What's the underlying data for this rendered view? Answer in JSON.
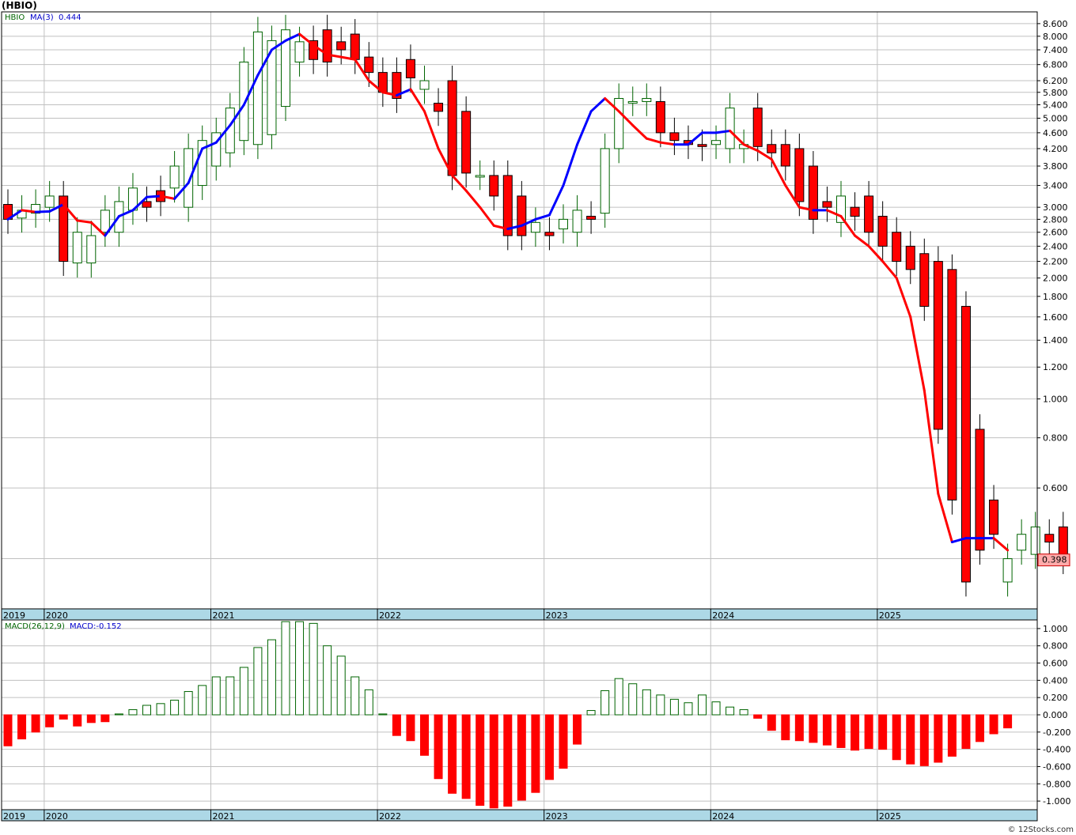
{
  "title": "(HBIO)",
  "price_panel": {
    "ticker": "HBIO",
    "ma_label": "MA(3)",
    "ma_value": "0.444",
    "last_price_label": "0.398",
    "y_ticks": [
      "8.600",
      "8.000",
      "7.400",
      "6.800",
      "6.200",
      "5.800",
      "5.400",
      "5.000",
      "4.600",
      "4.200",
      "3.800",
      "3.400",
      "3.000",
      "2.800",
      "2.600",
      "2.400",
      "2.200",
      "2.000",
      "1.800",
      "1.600",
      "1.400",
      "1.200",
      "1.000",
      "0.800",
      "0.600",
      "0.400"
    ]
  },
  "macd_panel": {
    "label": "MACD(26,12,9)",
    "value_label": "MACD:-0.152",
    "y_ticks": [
      "1.000",
      "0.800",
      "0.600",
      "0.400",
      "0.200",
      "0.000",
      "-0.200",
      "-0.400",
      "-0.600",
      "-0.800",
      "-1.000"
    ]
  },
  "year_labels": [
    "2019",
    "2020",
    "2021",
    "2022",
    "2023",
    "2024",
    "2025"
  ],
  "watermark": "© 12Stocks.com",
  "colors": {
    "up": "#006400",
    "down": "#ff0000",
    "ma_up": "#0000ff",
    "ma_down": "#ff0000",
    "axis_band": "#add8e6",
    "grid": "#c0c0c0",
    "price_box": "#ffaaaa"
  },
  "chart_data": [
    {
      "type": "candlestick",
      "scale": "log",
      "ylim": [
        0.3,
        9.2
      ],
      "x": [
        "2019-12",
        "2020-01",
        "2020-02",
        "2020-03",
        "2020-04",
        "2020-05",
        "2020-06",
        "2020-07",
        "2020-08",
        "2020-09",
        "2020-10",
        "2020-11",
        "2020-12",
        "2021-01",
        "2021-02",
        "2021-03",
        "2021-04",
        "2021-05",
        "2021-06",
        "2021-07",
        "2021-08",
        "2021-09",
        "2021-10",
        "2021-11",
        "2021-12",
        "2022-01",
        "2022-02",
        "2022-03",
        "2022-04",
        "2022-05",
        "2022-06",
        "2022-07",
        "2022-08",
        "2022-09",
        "2022-10",
        "2022-11",
        "2022-12",
        "2023-01",
        "2023-02",
        "2023-03",
        "2023-04",
        "2023-05",
        "2023-06",
        "2023-07",
        "2023-08",
        "2023-09",
        "2023-10",
        "2023-11",
        "2023-12",
        "2024-01",
        "2024-02",
        "2024-03",
        "2024-04",
        "2024-05",
        "2024-06",
        "2024-07",
        "2024-08",
        "2024-09",
        "2024-10",
        "2024-11",
        "2024-12",
        "2025-01",
        "2025-02",
        "2025-03",
        "2025-04",
        "2025-05",
        "2025-06",
        "2025-07",
        "2025-08",
        "2025-09",
        "2025-10",
        "2025-11",
        "2025-12"
      ],
      "series": [
        {
          "name": "HBIO",
          "open": [
            3.05,
            2.82,
            2.9,
            3.0,
            3.2,
            2.18,
            2.18,
            2.6,
            2.6,
            2.95,
            3.1,
            3.3,
            3.35,
            3.0,
            3.4,
            3.8,
            4.1,
            4.4,
            4.3,
            4.55,
            5.35,
            6.9,
            7.8,
            8.3,
            7.75,
            8.1,
            7.1,
            6.5,
            6.5,
            7.0,
            5.9,
            5.45,
            6.2,
            5.2,
            3.6,
            3.6,
            3.6,
            3.2,
            2.6,
            2.6,
            2.65,
            2.6,
            2.85,
            2.9,
            4.2,
            5.5,
            5.5,
            5.5,
            4.6,
            4.4,
            4.3,
            4.3,
            4.2,
            4.2,
            5.3,
            4.3,
            4.3,
            4.2,
            3.8,
            3.1,
            2.75,
            3.0,
            3.2,
            2.85,
            2.6,
            2.4,
            2.3,
            2.2,
            2.1,
            1.7,
            0.84,
            0.56,
            0.35,
            0.42,
            0.41,
            0.46,
            0.48,
            0.44
          ],
          "close": [
            2.8,
            2.95,
            3.05,
            3.2,
            2.2,
            2.6,
            2.55,
            2.95,
            3.1,
            3.35,
            3.0,
            3.1,
            3.8,
            4.2,
            4.4,
            4.6,
            5.3,
            6.9,
            8.2,
            7.8,
            8.3,
            7.75,
            7.0,
            6.9,
            7.4,
            7.0,
            6.5,
            5.8,
            5.6,
            6.3,
            6.2,
            5.2,
            3.6,
            3.65,
            3.6,
            3.2,
            2.55,
            2.55,
            2.75,
            2.55,
            2.8,
            2.95,
            2.8,
            4.2,
            5.6,
            5.5,
            5.6,
            4.6,
            4.4,
            4.3,
            4.25,
            4.4,
            5.3,
            4.3,
            4.25,
            4.1,
            3.8,
            3.1,
            2.8,
            3.0,
            3.2,
            2.85,
            2.6,
            2.4,
            2.2,
            2.1,
            1.7,
            0.84,
            0.56,
            0.35,
            0.42,
            0.46,
            0.4,
            0.46,
            0.48,
            0.44,
            0.398
          ]
        },
        {
          "name": "MA(3)",
          "values": [
            2.8,
            2.95,
            2.92,
            2.93,
            3.05,
            2.78,
            2.75,
            2.55,
            2.85,
            2.95,
            3.18,
            3.2,
            3.15,
            3.45,
            4.2,
            4.35,
            4.8,
            5.4,
            6.4,
            7.4,
            7.8,
            8.1,
            7.6,
            7.2,
            7.1,
            7.0,
            6.2,
            5.8,
            5.7,
            5.9,
            5.2,
            4.2,
            3.6,
            3.3,
            3.0,
            2.7,
            2.65,
            2.7,
            2.8,
            2.87,
            3.4,
            4.3,
            5.2,
            5.6,
            5.2,
            4.8,
            4.45,
            4.35,
            4.3,
            4.3,
            4.6,
            4.6,
            4.65,
            4.3,
            4.15,
            3.95,
            3.4,
            3.0,
            2.95,
            2.95,
            2.85,
            2.55,
            2.4,
            2.2,
            2.0,
            1.6,
            1.05,
            0.58,
            0.44,
            0.45,
            0.45,
            0.45,
            0.42
          ]
        }
      ]
    },
    {
      "type": "bar",
      "ylim": [
        -1.1,
        1.1
      ],
      "series": [
        {
          "name": "MACD(26,12,9)",
          "values": [
            -0.36,
            -0.28,
            -0.2,
            -0.14,
            -0.05,
            -0.13,
            -0.09,
            -0.08,
            0.01,
            0.06,
            0.11,
            0.13,
            0.17,
            0.27,
            0.34,
            0.44,
            0.44,
            0.55,
            0.78,
            0.87,
            1.08,
            1.08,
            1.06,
            0.8,
            0.68,
            0.44,
            0.29,
            0.01,
            -0.24,
            -0.3,
            -0.47,
            -0.74,
            -0.91,
            -0.97,
            -1.05,
            -1.08,
            -1.06,
            -0.99,
            -0.9,
            -0.75,
            -0.62,
            -0.34,
            0.05,
            0.28,
            0.42,
            0.36,
            0.29,
            0.23,
            0.18,
            0.14,
            0.23,
            0.15,
            0.09,
            0.06,
            -0.04,
            -0.18,
            -0.29,
            -0.3,
            -0.32,
            -0.35,
            -0.38,
            -0.41,
            -0.39,
            -0.4,
            -0.52,
            -0.57,
            -0.59,
            -0.55,
            -0.48,
            -0.39,
            -0.31,
            -0.22,
            -0.152
          ]
        }
      ]
    }
  ]
}
